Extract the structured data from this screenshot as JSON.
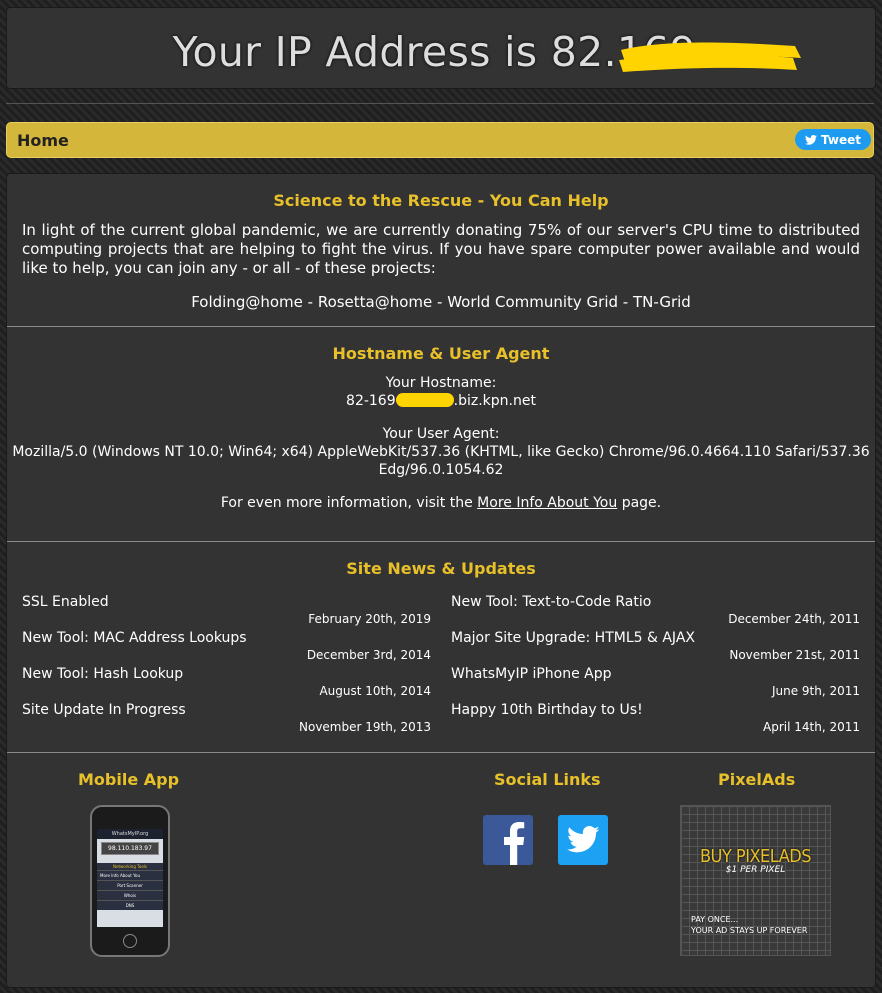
{
  "header": {
    "ip_title": "Your IP Address is 82.169."
  },
  "nav": {
    "home": "Home",
    "tweet": "Tweet"
  },
  "science": {
    "title": "Science to the Rescue - You Can Help",
    "paragraph": "In light of the current global pandemic, we are currently donating 75% of our server's CPU time to distributed computing projects that are helping to fight the virus. If you have spare computer power available and would like to help, you can join any - or all - of these projects:",
    "projects": "Folding@home - Rosetta@home - World Community Grid - TN-Grid"
  },
  "hostname_section": {
    "title": "Hostname & User Agent",
    "hostname_label": "Your Hostname:",
    "hostname_prefix": "82-169",
    "hostname_suffix": ".biz.kpn.net",
    "ua_label": "Your User Agent:",
    "ua_line1": "Mozilla/5.0 (Windows NT 10.0; Win64; x64) AppleWebKit/537.36 (KHTML, like Gecko) Chrome/96.0.4664.110 Safari/537.36",
    "ua_line2": "Edg/96.0.1054.62",
    "more_pre": "For even more information, visit the ",
    "more_link": "More Info About You",
    "more_post": " page."
  },
  "news": {
    "title": "Site News & Updates",
    "left": [
      {
        "title": "SSL Enabled",
        "date": "February 20th, 2019"
      },
      {
        "title": "New Tool: MAC Address Lookups",
        "date": "December 3rd, 2014"
      },
      {
        "title": "New Tool: Hash Lookup",
        "date": "August 10th, 2014"
      },
      {
        "title": "Site Update In Progress",
        "date": "November 19th, 2013"
      }
    ],
    "right": [
      {
        "title": "New Tool: Text-to-Code Ratio",
        "date": "December 24th, 2011"
      },
      {
        "title": "Major Site Upgrade: HTML5 & AJAX",
        "date": "November 21st, 2011"
      },
      {
        "title": "WhatsMyIP iPhone App",
        "date": "June 9th, 2011"
      },
      {
        "title": "Happy 10th Birthday to Us!",
        "date": "April 14th, 2011"
      }
    ]
  },
  "footer": {
    "mobile_title": "Mobile App",
    "social_title": "Social Links",
    "pixelads_title": "PixelAds",
    "pixelads_headline": "BUY PIXELADS",
    "pixelads_sub": "$1 PER PIXEL",
    "pixelads_line1": "PAY ONCE...",
    "pixelads_line2": "YOUR AD STAYS UP FOREVER"
  },
  "phone_screen": {
    "site": "WhatsMyIP.org",
    "ip": "98.110.183.97",
    "menu_title": "Networking Tools",
    "menu": [
      "More Info About You",
      "Port Scanner",
      "Whois",
      "DNS"
    ]
  },
  "colors": {
    "accent": "#e7c02a",
    "navbar": "#d4b63a",
    "redaction": "#ffd400",
    "facebook": "#3b5998",
    "twitter": "#1da1f2"
  }
}
